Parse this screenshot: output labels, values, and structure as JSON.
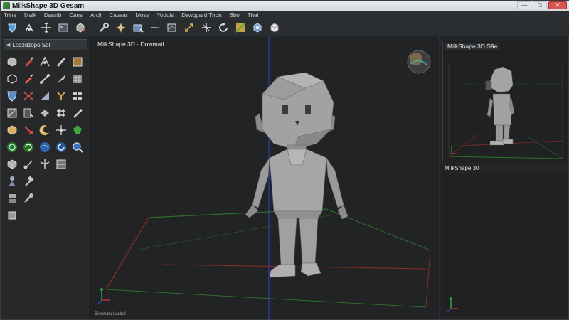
{
  "window": {
    "title": "MilkShape 3D Gesam",
    "controls": {
      "minimize": "—",
      "maximize": "□",
      "close": "✕"
    }
  },
  "menu": [
    "Trine",
    "Malk",
    "Dassib",
    "Cans",
    "Arcli",
    "Cavaar",
    "Moss",
    "Yoduls",
    "Dswqgard Thon",
    "Bbo",
    "Thei"
  ],
  "toolbar": {
    "icons": [
      "select-shield-icon",
      "move-axes-icon",
      "crosshair-icon",
      "viewport-icon",
      "cube-cut-icon",
      "wrench-icon",
      "star-burst-icon",
      "camera-icon",
      "arrows-icon",
      "frame-icon",
      "scale-icon",
      "arrow-move-icon",
      "rotate-icon",
      "texture-icon",
      "sphere-icon",
      "box-icon"
    ]
  },
  "left_panel": {
    "header": "Lodzdzopo Sdl"
  },
  "viewport": {
    "label": "MilkShape 3D · Dowmatl",
    "footer": "Sixnwatu Laslud"
  },
  "side_viewport": {
    "label": "MilkShape 3D Sãe"
  },
  "lower_panel": {
    "label": "MilkShape 30"
  },
  "colors": {
    "grid_red": "#8a2b25",
    "grid_green": "#2f6f2c",
    "axis_blue": "#2e3fa8",
    "model_gray": "#9a9a9a"
  }
}
